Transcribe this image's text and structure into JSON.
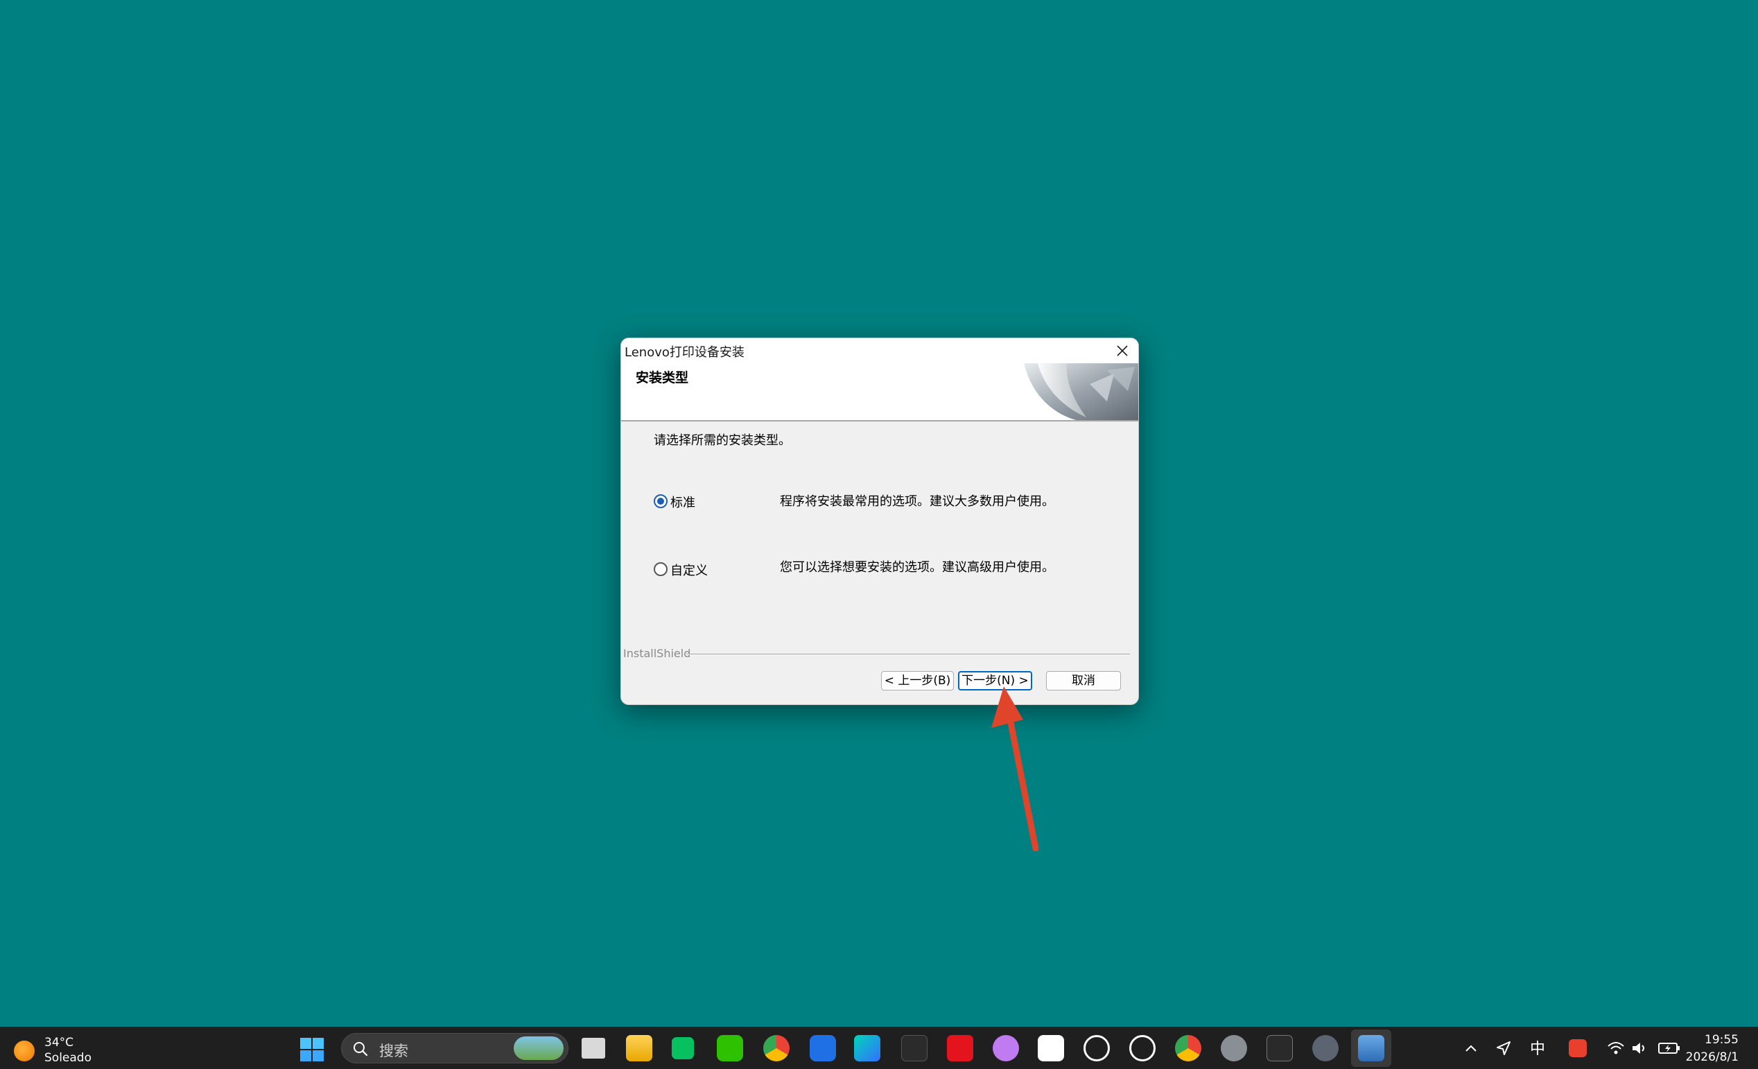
{
  "dialog": {
    "title": "Lenovo打印设备安装",
    "header_title": "安装类型",
    "prompt": "请选择所需的安装类型。",
    "options": [
      {
        "label": "标准",
        "description": "程序将安装最常用的选项。建议大多数用户使用。",
        "selected": true
      },
      {
        "label": "自定义",
        "description": "您可以选择想要安装的选项。建议高级用户使用。",
        "selected": false
      }
    ],
    "brand_label": "InstallShield",
    "buttons": {
      "back": "< 上一步(B)",
      "next": "下一步(N) >",
      "cancel": "取消"
    }
  },
  "annotation": {
    "arrow_color": "#e0452b"
  },
  "taskbar": {
    "weather": {
      "temp": "34°C",
      "condition": "Soleado"
    },
    "search_placeholder": "搜索",
    "ime_indicator": "中",
    "clock": {
      "time": "19:55",
      "date": "2026/8/1"
    },
    "pinned_apps": [
      "task-view-icon",
      "file-explorer-icon",
      "green-app-icon",
      "wechat-icon",
      "chrome-icon",
      "lenovo-l-icon",
      "feishu-icon",
      "unity-icon",
      "wps-icon",
      "cat-app-icon",
      "qq-icon",
      "chatgpt-icon",
      "chatgpt-icon",
      "chrome-beta-icon",
      "settings-icon",
      "box-app-icon",
      "feather-app-icon",
      "printer-setup-icon"
    ]
  },
  "colors": {
    "desktop": "#008080",
    "taskbar": "#1f1f1f",
    "accent": "#0067c0"
  }
}
